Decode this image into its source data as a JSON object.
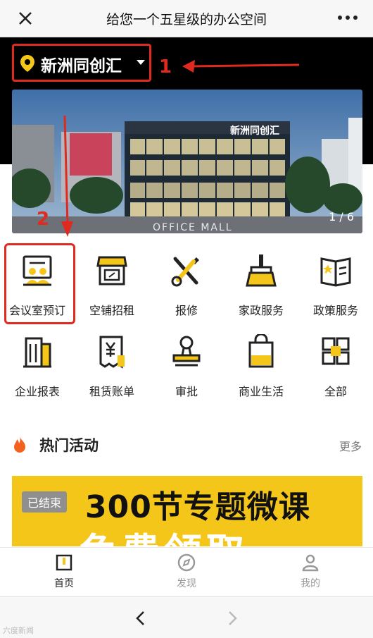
{
  "header": {
    "title": "给您一个五星级的办公空间"
  },
  "location": {
    "name": "新洲同创汇"
  },
  "annotations": {
    "n1": "1",
    "n2": "2"
  },
  "banner": {
    "pager": "1 / 6",
    "sign": "新洲同创汇",
    "mall_text": "OFFICE MALL"
  },
  "services": [
    {
      "label": "会议室预订",
      "icon": "meeting-room-icon"
    },
    {
      "label": "空铺招租",
      "icon": "shop-icon"
    },
    {
      "label": "报修",
      "icon": "repair-tools-icon"
    },
    {
      "label": "家政服务",
      "icon": "broom-icon"
    },
    {
      "label": "政策服务",
      "icon": "policy-book-icon"
    },
    {
      "label": "企业报表",
      "icon": "building-icon"
    },
    {
      "label": "租赁账单",
      "icon": "bill-icon"
    },
    {
      "label": "审批",
      "icon": "stamp-icon"
    },
    {
      "label": "商业生活",
      "icon": "shopping-bag-icon"
    },
    {
      "label": "全部",
      "icon": "grid-all-icon"
    }
  ],
  "section": {
    "title": "热门活动",
    "more": "更多"
  },
  "activity": {
    "tag": "已结束",
    "headline": "300节专题微课",
    "subline": "免费领取"
  },
  "tabs": [
    {
      "label": "首页"
    },
    {
      "label": "发现"
    },
    {
      "label": "我的"
    }
  ],
  "watermark": "六度新闻",
  "colors": {
    "accent": "#f5c61a",
    "highlight": "#e12a1f",
    "hot": "#f2611d"
  }
}
